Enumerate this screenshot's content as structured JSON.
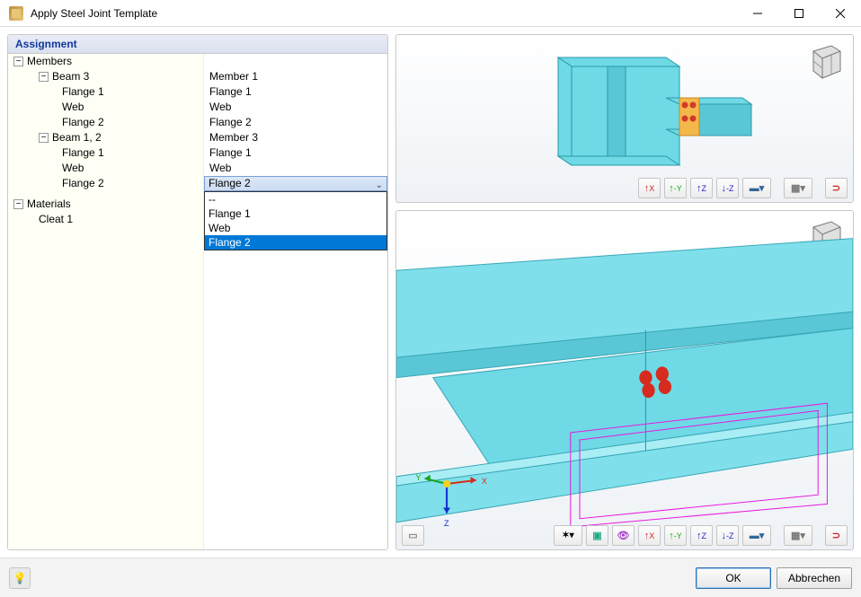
{
  "window": {
    "title": "Apply Steel Joint Template"
  },
  "panel": {
    "header": "Assignment"
  },
  "tree": {
    "members_label": "Members",
    "beam3": {
      "label": "Beam 3",
      "flange1": "Flange 1",
      "web": "Web",
      "flange2": "Flange 2",
      "r_member": "Member 1",
      "r_flange1": "Flange 1",
      "r_web": "Web",
      "r_flange2": "Flange 2"
    },
    "beam12": {
      "label": "Beam 1, 2",
      "flange1": "Flange 1",
      "web": "Web",
      "flange2": "Flange 2",
      "r_member": "Member 3",
      "r_flange1": "Flange 1",
      "r_web": "Web",
      "r_flange2_selected": "Flange 2"
    },
    "materials_label": "Materials",
    "cleat1": "Cleat 1"
  },
  "dropdown": {
    "options": [
      "--",
      "Flange 1",
      "Web",
      "Flange 2"
    ],
    "selected": "Flange 2"
  },
  "toolbar": {
    "x_pos": "X",
    "y_neg": "-Y",
    "z_pos": "Z",
    "z_neg": "-Z",
    "axes": {
      "x": "X",
      "y": "Y",
      "z": "Z"
    }
  },
  "footer": {
    "ok": "OK",
    "cancel": "Abbrechen"
  }
}
